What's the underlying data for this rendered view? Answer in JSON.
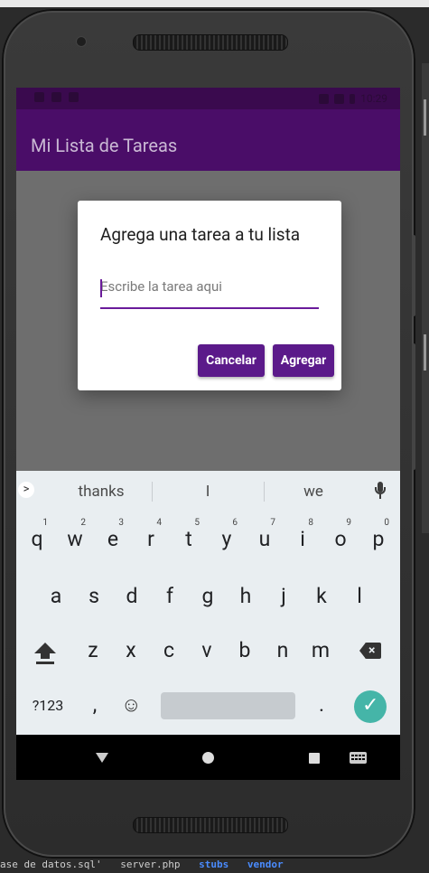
{
  "app": {
    "title": "Mi Lista de Tareas"
  },
  "statusbar": {
    "time": "10:29"
  },
  "dialog": {
    "title": "Agrega una tarea a tu lista",
    "input_placeholder": "Escribe la tarea aqui",
    "cancel_label": "Cancelar",
    "add_label": "Agregar"
  },
  "fab": {
    "label": "+"
  },
  "keyboard": {
    "suggestions": [
      "thanks",
      "I",
      "we"
    ],
    "row1": [
      {
        "key": "q",
        "num": "1"
      },
      {
        "key": "w",
        "num": "2"
      },
      {
        "key": "e",
        "num": "3"
      },
      {
        "key": "r",
        "num": "4"
      },
      {
        "key": "t",
        "num": "5"
      },
      {
        "key": "y",
        "num": "6"
      },
      {
        "key": "u",
        "num": "7"
      },
      {
        "key": "i",
        "num": "8"
      },
      {
        "key": "o",
        "num": "9"
      },
      {
        "key": "p",
        "num": "0"
      }
    ],
    "row2": [
      "a",
      "s",
      "d",
      "f",
      "g",
      "h",
      "j",
      "k",
      "l"
    ],
    "row3": [
      "z",
      "x",
      "c",
      "v",
      "b",
      "n",
      "m"
    ],
    "symbols_label": "?123",
    "comma_label": ",",
    "period_label": ".",
    "emoji_label": "☺",
    "suggest_arrow": ">",
    "enter_icon": "✓"
  },
  "background": {
    "ide_items": [
      "ase de datos.sql'",
      "server.php",
      "stubs",
      "vendor"
    ]
  },
  "colors": {
    "appbar": "#4a0d68",
    "statusbar": "#3a0a4e",
    "button": "#5b1a8a",
    "accent_underline": "#6a1b9a",
    "enter_key": "#45b5a8"
  }
}
